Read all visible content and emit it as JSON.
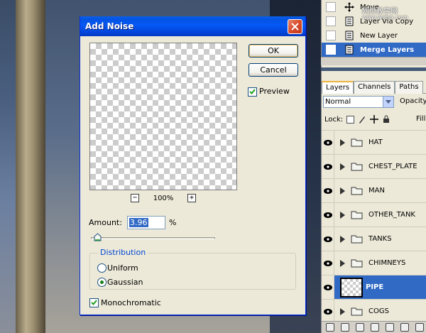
{
  "dialog": {
    "title": "Add Noise",
    "ok_label": "OK",
    "cancel_label": "Cancel",
    "preview_label": "Preview",
    "preview_checked": true,
    "zoom": {
      "minus": "−",
      "plus": "+",
      "value": "100%"
    },
    "amount_label": "Amount:",
    "amount_value": "3.96",
    "amount_unit": "%",
    "distribution_title": "Distribution",
    "distribution_options": [
      "Uniform",
      "Gaussian"
    ],
    "distribution_selected": "Gaussian",
    "monochromatic_label": "Monochromatic",
    "monochromatic_checked": true
  },
  "history": {
    "items": [
      {
        "label": "Move",
        "selected": false
      },
      {
        "label": "Layer Via Copy",
        "selected": false
      },
      {
        "label": "New Layer",
        "selected": false
      },
      {
        "label": "Merge Layers",
        "selected": true
      }
    ],
    "watermark": "网页教学网",
    "watermark_url": "www.webjx.com"
  },
  "layers": {
    "tabs": [
      "Layers",
      "Channels",
      "Paths"
    ],
    "active_tab": "Layers",
    "blend_mode": "Normal",
    "opacity_label": "Opacity",
    "lock_label": "Lock:",
    "fill_label": "Fill:",
    "items": [
      {
        "name": "HAT",
        "type": "group"
      },
      {
        "name": "CHEST_PLATE",
        "type": "group"
      },
      {
        "name": "MAN",
        "type": "group"
      },
      {
        "name": "OTHER_TANK",
        "type": "group"
      },
      {
        "name": "TANKS",
        "type": "group"
      },
      {
        "name": "CHIMNEYS",
        "type": "group"
      },
      {
        "name": "PIPE",
        "type": "layer",
        "selected": true
      },
      {
        "name": "COGS",
        "type": "group"
      }
    ]
  }
}
